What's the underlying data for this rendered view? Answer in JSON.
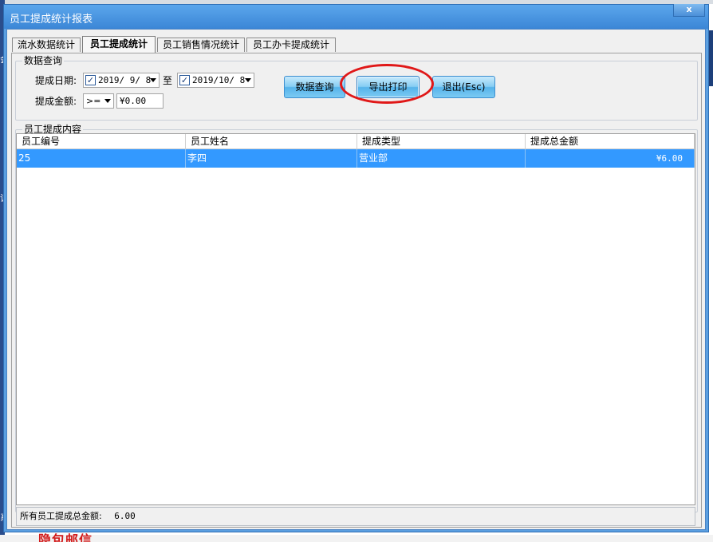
{
  "background": {
    "left_chars": [
      "会",
      "诉",
      "系"
    ],
    "bottom_text": "隐包邮信"
  },
  "window": {
    "title": "员工提成统计报表",
    "close_label": "x"
  },
  "tabs": [
    {
      "label": "流水数据统计",
      "active": false
    },
    {
      "label": "员工提成统计",
      "active": true
    },
    {
      "label": "员工销售情况统计",
      "active": false
    },
    {
      "label": "员工办卡提成统计",
      "active": false
    }
  ],
  "query": {
    "group_label": "数据查询",
    "date_label": "提成日期:",
    "date_from": {
      "checked": true,
      "value": "2019/ 9/ 8"
    },
    "date_sep": "至",
    "date_to": {
      "checked": true,
      "value": "2019/10/ 8"
    },
    "amount_label": "提成金额:",
    "amount_operator": ">=",
    "amount_value": "¥0.00"
  },
  "buttons": {
    "query": "数据查询",
    "export": "导出打印",
    "exit": "退出(Esc)"
  },
  "content": {
    "group_label": "员工提成内容",
    "columns": [
      "员工编号",
      "员工姓名",
      "提成类型",
      "提成总金额"
    ],
    "rows": [
      {
        "id": "25",
        "name": "李四",
        "type": "营业部",
        "total": "¥6.00",
        "selected": true
      }
    ]
  },
  "summary": {
    "label": "所有员工提成总金额:",
    "value": "6.00"
  },
  "colors": {
    "title_bar": "#3b86d6",
    "selection": "#3399ff",
    "annotation": "#e01818"
  }
}
